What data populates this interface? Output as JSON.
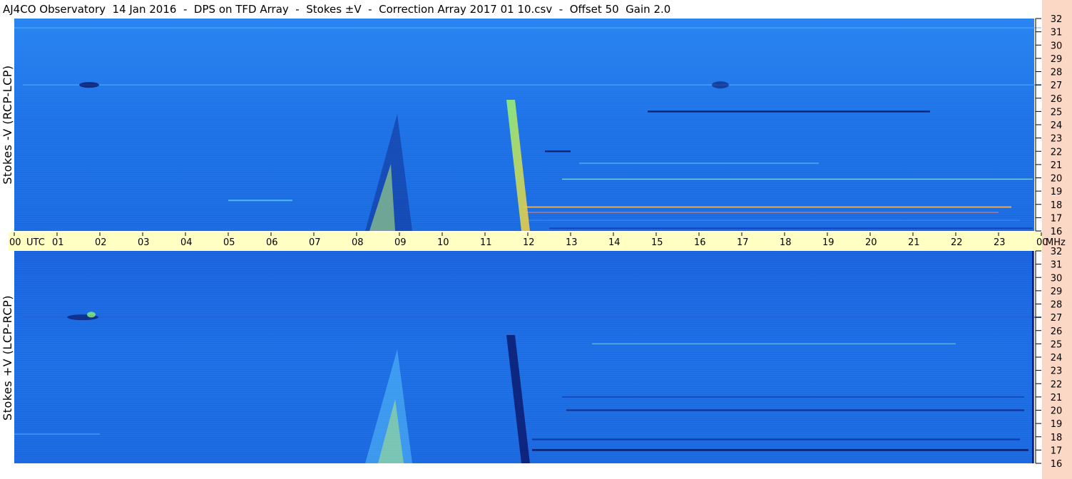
{
  "title": "AJ4CO Observatory  14 Jan 2016  -  DPS on TFD Array  -  Stokes ±V  -  Correction Array 2017 01 10.csv  -  Offset 50  Gain 2.0",
  "colors": {
    "background_blue": "#1d6fe8",
    "utc_band": "#ffffc4",
    "side_panel": "#fbd8c6",
    "burst_dark": "#0a1a6e",
    "burst_bright": "#7cff6e"
  },
  "chart_data": [
    {
      "type": "heatmap",
      "name": "top-panel",
      "ylabel": "Stokes -V (RCP-LCP)",
      "x_axis": "UTC hours",
      "y_axis": "MHz",
      "ylim": [
        16,
        32
      ],
      "y_ticks": [
        "16",
        "17",
        "18",
        "19",
        "20",
        "21",
        "22",
        "23",
        "24",
        "25",
        "26",
        "27",
        "28",
        "29",
        "30",
        "31",
        "32"
      ]
    },
    {
      "type": "heatmap",
      "name": "bottom-panel",
      "ylabel": "Stokes +V (LCP-RCP)",
      "x_axis": "UTC hours",
      "y_axis": "MHz",
      "ylim": [
        16,
        32
      ],
      "y_ticks": [
        "16",
        "17",
        "18",
        "19",
        "20",
        "21",
        "22",
        "23",
        "24",
        "25",
        "26",
        "27",
        "28",
        "29",
        "30",
        "31",
        "32"
      ]
    }
  ],
  "time_axis": {
    "ticks": [
      "00",
      "01",
      "02",
      "03",
      "04",
      "05",
      "06",
      "07",
      "08",
      "09",
      "10",
      "11",
      "12",
      "13",
      "14",
      "15",
      "16",
      "17",
      "18",
      "19",
      "20",
      "21",
      "22",
      "23",
      "00"
    ],
    "start_label": "UTC",
    "end_label": "MHz"
  }
}
